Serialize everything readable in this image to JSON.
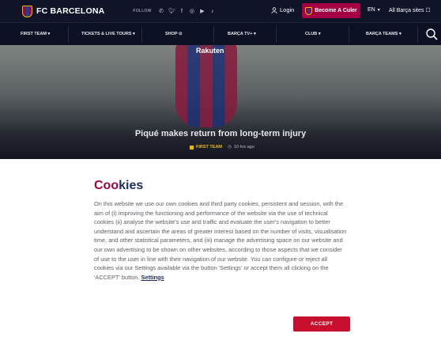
{
  "header": {
    "logo_text": "FC BARCELONA",
    "follow_label": "FOLLOW",
    "social_icons": [
      "whatsapp-icon",
      "twitter-icon",
      "facebook-icon",
      "instagram-icon",
      "youtube-icon",
      "tiktok-icon"
    ],
    "login_label": "Login",
    "cule_button": "Become A Culer",
    "language": "EN",
    "sites_label": "All Barça sites"
  },
  "nav": {
    "items": [
      "FIRST TEAM",
      "TICKETS & LIVE TOURS",
      "SHOP",
      "BARÇA TV+",
      "CLUB",
      "BARÇA TEAMS"
    ]
  },
  "hero": {
    "sponsor": "Rakuten",
    "title": "Piqué makes return from long-term injury",
    "tag": "FIRST TEAM",
    "time": "10 hrs ago"
  },
  "cookie": {
    "title_part1": "Coo",
    "title_part2": "kies",
    "body": "On this website we use our own cookies and third party cookies, persistent and session, with the aim of (i) improving the functioning and performance of the website via the use of technical cookies (ii) analyse the website's use and traffic and evaluate the user's navigation to better understand and ascertain the areas of greater interest based on the number of visits, visualisation time, and other statistical parameters, and (iii) manage the advertising space on our website and our own advertising to be shown on other websites, according to those aspects that we consider of use to the user in line with their navigation of our website. You can configure or reject all cookies via our Settings available via the button 'Settings' or accept them all clicking on the 'ACCEPT' button.",
    "settings_link": "Settings",
    "accept_label": "ACCEPT"
  },
  "colors": {
    "header_bg": "#0f1429",
    "brand_red": "#a50044",
    "brand_blue": "#1e2d5e",
    "accent_yellow": "#edbb00",
    "accept_bg": "#c8102e"
  }
}
